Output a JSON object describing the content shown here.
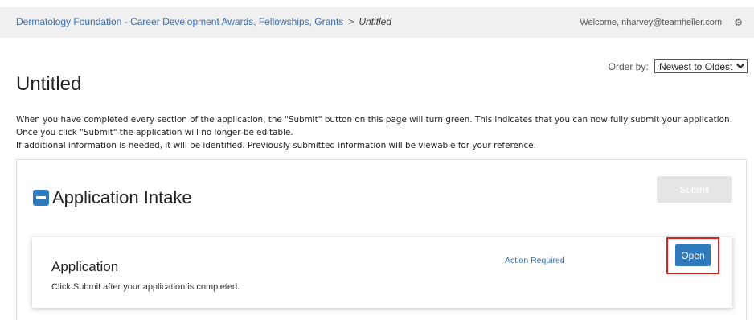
{
  "header": {
    "breadcrumb_link": "Dermatology Foundation - Career Development Awards, Fellowships, Grants",
    "separator": ">",
    "breadcrumb_current": "Untitled",
    "welcome": "Welcome, nharvey@teamheller.com",
    "settings_icon": "⚙"
  },
  "order_by": {
    "label": "Order by:",
    "selected": "Newest to Oldest"
  },
  "page_title": "Untitled",
  "instructions": {
    "line1": "When you have completed every section of the application, the \"Submit\" button on this page will turn green. This indicates that you can now fully submit your application. Once you click \"Submit\" the application will no longer be editable.",
    "line2": "If additional information is needed, it will be identified. Previously submitted information will be viewable for your reference."
  },
  "section": {
    "title": "Application Intake",
    "submit_label": "Submit"
  },
  "card": {
    "title": "Application",
    "description": "Click Submit after your application is completed.",
    "status": "Action Required",
    "open_label": "Open"
  },
  "colors": {
    "primary": "#2f79bd",
    "link": "#3a6fb0",
    "highlight": "#e01e1e",
    "disabled": "#e5e5e5"
  }
}
